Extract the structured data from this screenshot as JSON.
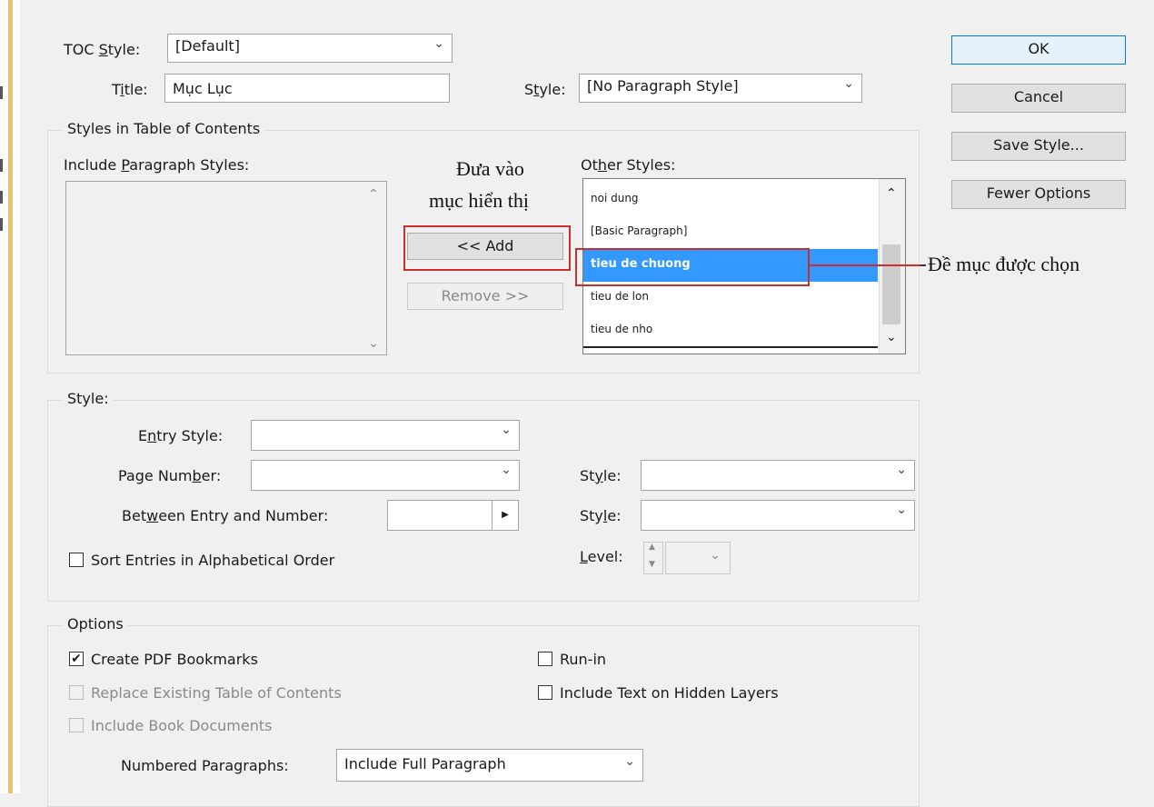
{
  "toc_style": {
    "label_prefix": "TOC ",
    "label_ul": "S",
    "label_suffix": "tyle:",
    "value": "[Default]"
  },
  "title": {
    "label_prefix": "T",
    "label_ul": "i",
    "label_suffix": "tle:",
    "value": "Mục Lục"
  },
  "title_style": {
    "label_prefix": "S",
    "label_ul": "t",
    "label_suffix": "yle:",
    "value": "[No Paragraph Style]"
  },
  "buttons": {
    "ok": "OK",
    "cancel": "Cancel",
    "save_style": "Save Style...",
    "fewer_options": "Fewer Options"
  },
  "styles_group": {
    "title": "Styles in Table of Contents",
    "include_label_prefix": "Include ",
    "include_label_ul": "P",
    "include_label_suffix": "aragraph Styles:",
    "add_button": "<< Add",
    "remove_button": "Remove >>",
    "other_label_prefix": "Ot",
    "other_label_ul": "h",
    "other_label_suffix": "er Styles:",
    "other_styles": [
      "noi dung",
      "[Basic Paragraph]",
      "tieu de chuong",
      "tieu de lon",
      "tieu de nho"
    ],
    "selected_index": 2
  },
  "annotations": {
    "add_line1": "Đưa vào",
    "add_line2": "mục hiển thị",
    "selected_callout": "Đề mục được chọn"
  },
  "style_group": {
    "title": "Style:",
    "entry_style": {
      "prefix": "E",
      "ul": "n",
      "suffix": "try Style:",
      "value": ""
    },
    "page_number": {
      "prefix": "Page Num",
      "ul": "b",
      "suffix": "er:",
      "value": ""
    },
    "page_number_style": {
      "prefix": "St",
      "ul": "y",
      "suffix": "le:",
      "value": ""
    },
    "between": {
      "prefix": "Bet",
      "ul": "w",
      "suffix": "een Entry and Number:",
      "value": ""
    },
    "between_style": {
      "prefix": "Sty",
      "ul": "l",
      "suffix": "e:",
      "value": ""
    },
    "sort_label": "Sort Entries in Alphabetical Order",
    "level": {
      "ul": "L",
      "suffix": "evel:",
      "value": ""
    }
  },
  "options_group": {
    "title": "Options",
    "create_pdf_bookmarks": "Create PDF Bookmarks",
    "create_pdf_bookmarks_checked": true,
    "replace_existing": "Replace Existing Table of Contents",
    "include_book_documents": "Include Book Documents",
    "run_in": "Run-in",
    "include_hidden_layers": "Include Text on Hidden Layers",
    "numbered_paragraphs": {
      "prefix": "Numbered Para",
      "ul": "g",
      "suffix": "raphs:",
      "value": "Include Full Paragraph"
    }
  },
  "colors": {
    "selection": "#3399ff",
    "annotation_red": "#c9302c",
    "ok_border": "#0078d7"
  }
}
